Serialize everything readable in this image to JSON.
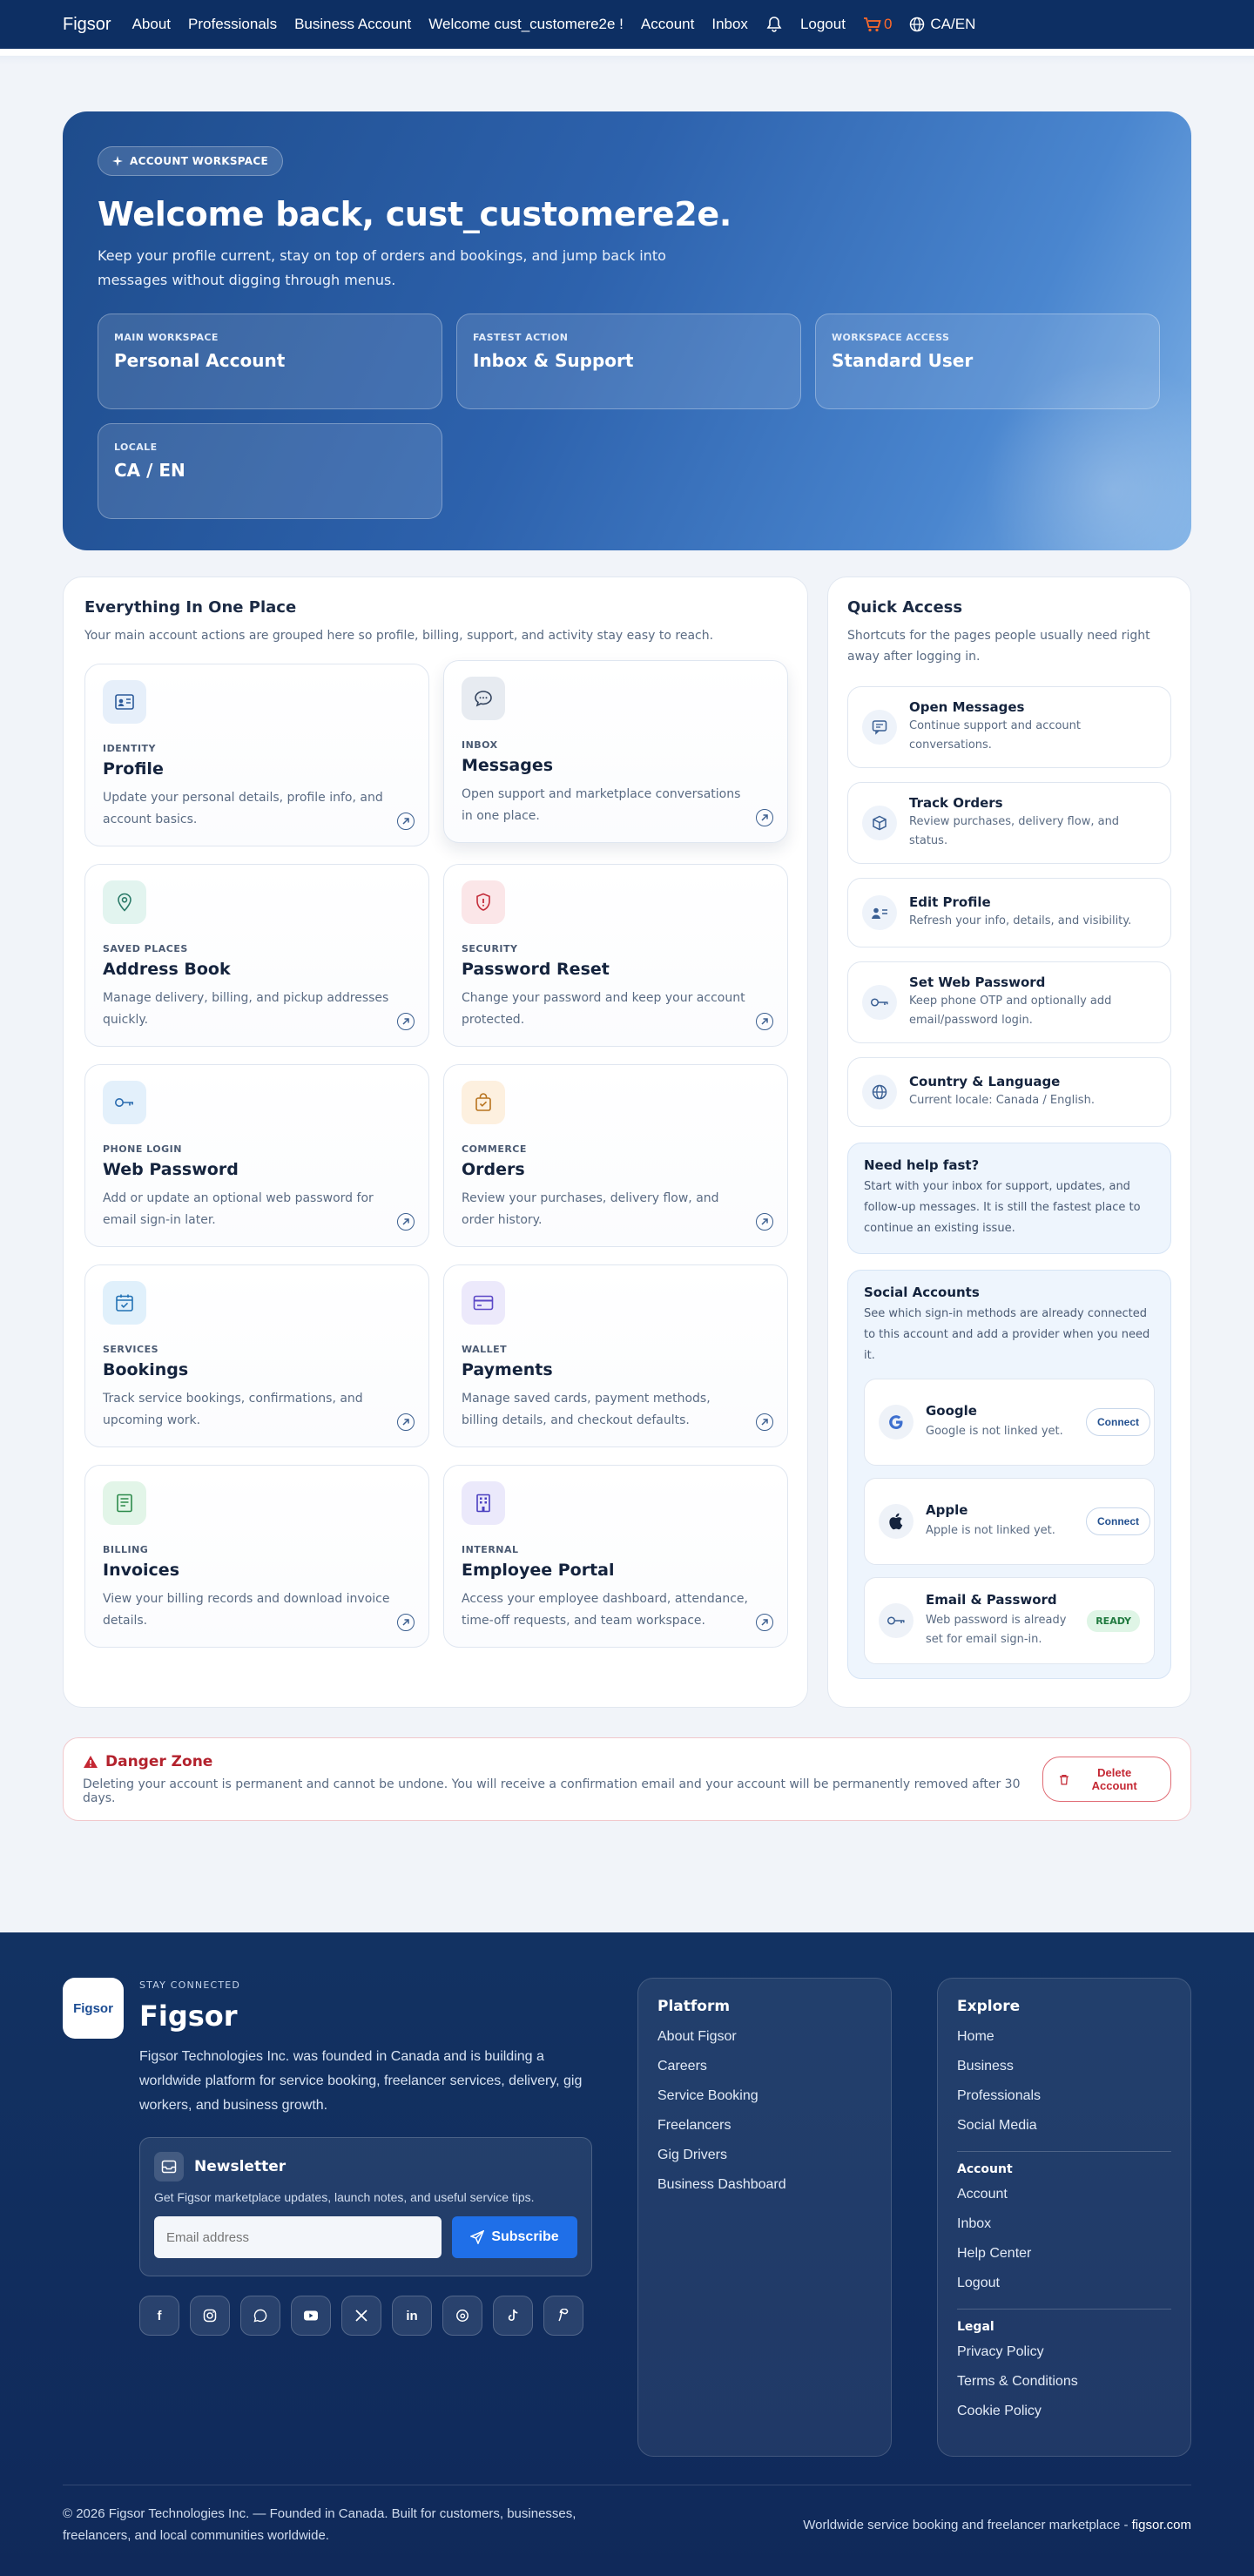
{
  "nav": {
    "brand": "Figsor",
    "links": [
      "About",
      "Professionals",
      "Business Account",
      "Welcome cust_customere2e !",
      "Account",
      "Inbox"
    ],
    "logout": "Logout",
    "cart_count": "0",
    "locale": "CA/EN"
  },
  "hero": {
    "badge": "ACCOUNT WORKSPACE",
    "title": "Welcome back, cust_customere2e.",
    "subtitle": "Keep your profile current, stay on top of orders and bookings, and jump back into messages without digging through menus.",
    "cards": [
      {
        "label": "MAIN WORKSPACE",
        "value": "Personal Account"
      },
      {
        "label": "FASTEST ACTION",
        "value": "Inbox & Support"
      },
      {
        "label": "WORKSPACE ACCESS",
        "value": "Standard User"
      },
      {
        "label": "LOCALE",
        "value": "CA / EN"
      }
    ]
  },
  "overview": {
    "title": "Everything In One Place",
    "subtitle": "Your main account actions are grouped here so profile, billing, support, and activity stay easy to reach.",
    "cards": [
      {
        "kicker": "IDENTITY",
        "title": "Profile",
        "desc": "Update your personal details, profile info, and account basics.",
        "icon": "id-card-icon",
        "color": "#e6effa",
        "accent": "#2c5a9a"
      },
      {
        "kicker": "INBOX",
        "title": "Messages",
        "desc": "Open support and marketplace conversations in one place.",
        "icon": "chat-bubble-icon",
        "color": "#e7ebf1",
        "accent": "#34445e"
      },
      {
        "kicker": "SAVED PLACES",
        "title": "Address Book",
        "desc": "Manage delivery, billing, and pickup addresses quickly.",
        "icon": "map-pin-icon",
        "color": "#e2f4ef",
        "accent": "#2a7a68"
      },
      {
        "kicker": "SECURITY",
        "title": "Password Reset",
        "desc": "Change your password and keep your account protected.",
        "icon": "shield-icon",
        "color": "#fbe6e8",
        "accent": "#c42c3a"
      },
      {
        "kicker": "PHONE LOGIN",
        "title": "Web Password",
        "desc": "Add or update an optional web password for email sign-in later.",
        "icon": "key-icon",
        "color": "#e3f0fb",
        "accent": "#2b6cb0"
      },
      {
        "kicker": "COMMERCE",
        "title": "Orders",
        "desc": "Review your purchases, delivery flow, and order history.",
        "icon": "shopping-bag-icon",
        "color": "#fdf0df",
        "accent": "#b8731e"
      },
      {
        "kicker": "SERVICES",
        "title": "Bookings",
        "desc": "Track service bookings, confirmations, and upcoming work.",
        "icon": "calendar-check-icon",
        "color": "#e0f0fb",
        "accent": "#2372b5"
      },
      {
        "kicker": "WALLET",
        "title": "Payments",
        "desc": "Manage saved cards, payment methods, billing details, and checkout defaults.",
        "icon": "credit-card-icon",
        "color": "#ece9fb",
        "accent": "#5b48c7"
      },
      {
        "kicker": "BILLING",
        "title": "Invoices",
        "desc": "View your billing records and download invoice details.",
        "icon": "invoice-icon",
        "color": "#e2f5e8",
        "accent": "#2c8a4b"
      },
      {
        "kicker": "INTERNAL",
        "title": "Employee Portal",
        "desc": "Access your employee dashboard, attendance, time-off requests, and team workspace.",
        "icon": "building-icon",
        "color": "#ebe9fb",
        "accent": "#4a3fc0"
      }
    ]
  },
  "quick": {
    "title": "Quick Access",
    "subtitle": "Shortcuts for the pages people usually need right away after logging in.",
    "items": [
      {
        "title": "Open Messages",
        "desc": "Continue support and account conversations.",
        "icon": "message-icon"
      },
      {
        "title": "Track Orders",
        "desc": "Review purchases, delivery flow, and status.",
        "icon": "box-icon"
      },
      {
        "title": "Edit Profile",
        "desc": "Refresh your info, details, and visibility.",
        "icon": "user-card-icon"
      },
      {
        "title": "Set Web Password",
        "desc": "Keep phone OTP and optionally add email/password login.",
        "icon": "key-icon"
      },
      {
        "title": "Country & Language",
        "desc": "Current locale: Canada / English.",
        "icon": "globe-icon"
      }
    ],
    "help": {
      "title": "Need help fast?",
      "desc": "Start with your inbox for support, updates, and follow-up messages. It is still the fastest place to continue an existing issue."
    },
    "social": {
      "title": "Social Accounts",
      "desc": "See which sign-in methods are already connected to this account and add a provider when you need it.",
      "providers": [
        {
          "name": "Google",
          "status": "Google is not linked yet.",
          "action": "Connect",
          "icon": "google-icon"
        },
        {
          "name": "Apple",
          "status": "Apple is not linked yet.",
          "action": "Connect",
          "icon": "apple-icon"
        },
        {
          "name": "Email & Password",
          "status": "Web password is already set for email sign-in.",
          "action": "READY",
          "icon": "key-icon"
        }
      ]
    }
  },
  "danger": {
    "title": "Danger Zone",
    "desc": "Deleting your account is permanent and cannot be undone. You will receive a confirmation email and your account will be permanently removed after 30 days.",
    "button": "Delete Account"
  },
  "footer": {
    "logo": "Figsor",
    "kicker": "STAY CONNECTED",
    "brand": "Figsor",
    "about": "Figsor Technologies Inc. was founded in Canada and is building a worldwide platform for service booking, freelancer services, delivery, gig workers, and business growth.",
    "newsletter": {
      "title": "Newsletter",
      "desc": "Get Figsor marketplace updates, launch notes, and useful service tips.",
      "placeholder": "Email address",
      "button": "Subscribe"
    },
    "socials": [
      "facebook-icon",
      "instagram-icon",
      "whatsapp-icon",
      "youtube-icon",
      "x-icon",
      "linkedin-icon",
      "threads-icon",
      "tiktok-icon",
      "pinterest-icon"
    ],
    "platform": {
      "title": "Platform",
      "links": [
        "About Figsor",
        "Careers",
        "Service Booking",
        "Freelancers",
        "Gig Drivers",
        "Business Dashboard"
      ]
    },
    "explore": {
      "title": "Explore",
      "links": [
        "Home",
        "Business",
        "Professionals",
        "Social Media"
      ]
    },
    "account": {
      "title": "Account",
      "links": [
        "Account",
        "Inbox",
        "Help Center",
        "Logout"
      ]
    },
    "legal": {
      "title": "Legal",
      "links": [
        "Privacy Policy",
        "Terms & Conditions",
        "Cookie Policy"
      ]
    },
    "copyright": "© 2026 Figsor Technologies Inc. — Founded in Canada. Built for customers, businesses, freelancers, and local communities worldwide.",
    "tagline": "Worldwide service booking and freelancer marketplace - ",
    "domain": "figsor.com"
  }
}
